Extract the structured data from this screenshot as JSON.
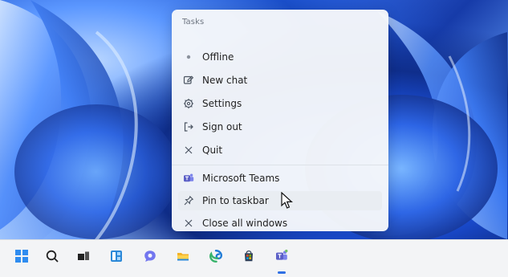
{
  "menu": {
    "header": "Tasks",
    "items": [
      {
        "label": "Offline",
        "icon": "offline-dot-icon"
      },
      {
        "label": "New chat",
        "icon": "new-chat-icon"
      },
      {
        "label": "Settings",
        "icon": "gear-icon"
      },
      {
        "label": "Sign out",
        "icon": "sign-out-icon"
      },
      {
        "label": "Quit",
        "icon": "close-icon"
      },
      {
        "label": "Microsoft Teams",
        "icon": "teams-icon"
      },
      {
        "label": "Pin to taskbar",
        "icon": "pin-icon"
      },
      {
        "label": "Close all windows",
        "icon": "close-icon"
      }
    ],
    "hovered_item": "Pin to taskbar"
  },
  "taskbar": {
    "icons": [
      {
        "name": "start-icon"
      },
      {
        "name": "search-icon"
      },
      {
        "name": "task-view-icon"
      },
      {
        "name": "widgets-icon"
      },
      {
        "name": "chat-icon"
      },
      {
        "name": "file-explorer-icon"
      },
      {
        "name": "edge-icon"
      },
      {
        "name": "store-icon"
      },
      {
        "name": "teams-icon"
      }
    ]
  },
  "colors": {
    "accent": "#2f6fe4",
    "teams": "#5b5fc7",
    "explorer": "#f3b329",
    "edge_blue": "#1e7ad6",
    "edge_green": "#37b36b"
  }
}
